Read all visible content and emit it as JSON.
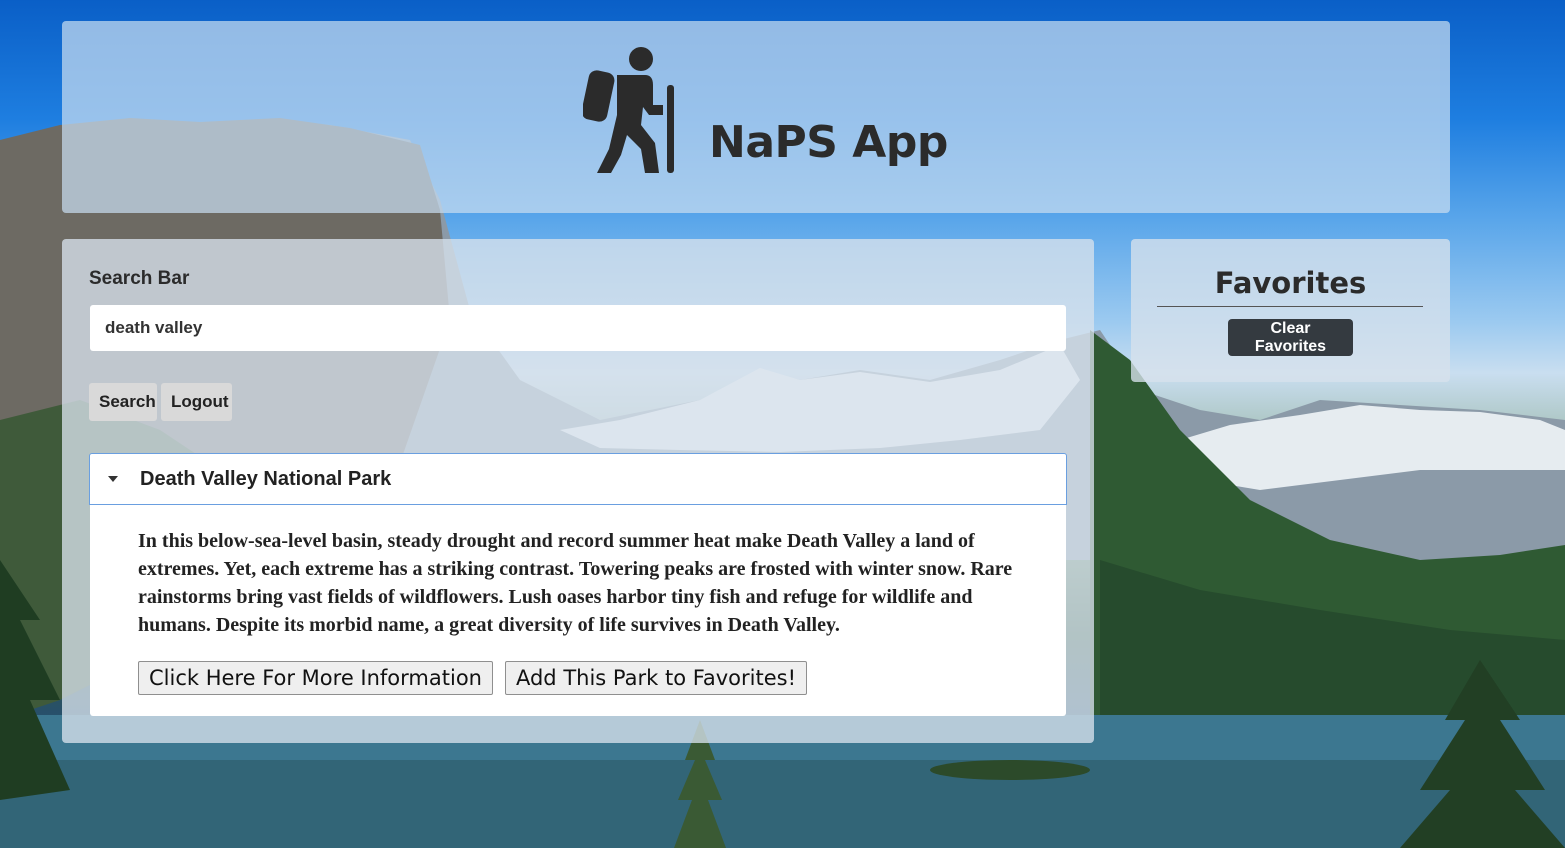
{
  "header": {
    "app_title": "NaPS App",
    "logo_icon": "hiker-icon"
  },
  "search": {
    "label": "Search Bar",
    "value": "death valley",
    "search_button": "Search",
    "logout_button": "Logout"
  },
  "results": [
    {
      "park_name": "Death Valley National Park",
      "expanded": true,
      "description": "In this below-sea-level basin, steady drought and record summer heat make Death Valley a land of extremes. Yet, each extreme has a striking contrast. Towering peaks are frosted with winter snow. Rare rainstorms bring vast fields of wildflowers. Lush oases harbor tiny fish and refuge for wildlife and humans. Despite its morbid name, a great diversity of life survives in Death Valley.",
      "more_info_button": "Click Here For More Information",
      "favorite_button": "Add This Park to Favorites!"
    }
  ],
  "favorites": {
    "title": "Favorites",
    "clear_button": "Clear Favorites",
    "items": []
  },
  "colors": {
    "clear_button_bg": "#343a40",
    "accordion_border": "#6a9fe0",
    "sky_top": "#0a5fc7"
  }
}
